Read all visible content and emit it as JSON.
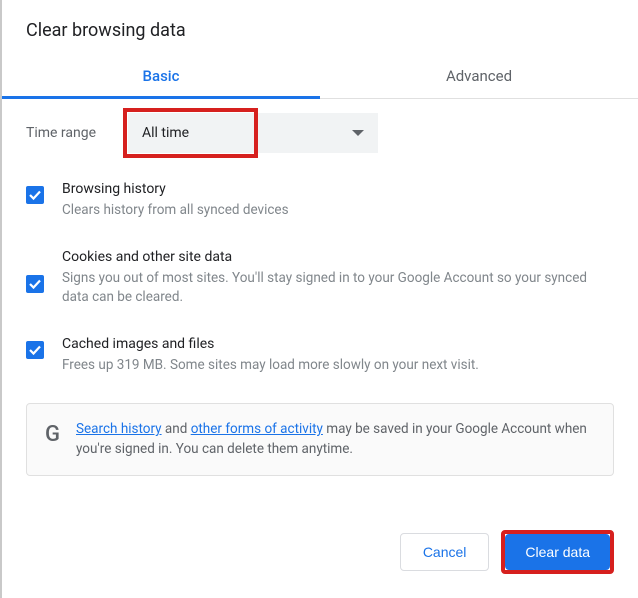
{
  "title": "Clear browsing data",
  "tabs": {
    "basic": "Basic",
    "advanced": "Advanced"
  },
  "time_range": {
    "label": "Time range",
    "selected": "All time"
  },
  "options": [
    {
      "title": "Browsing history",
      "desc": "Clears history from all synced devices"
    },
    {
      "title": "Cookies and other site data",
      "desc": "Signs you out of most sites. You'll stay signed in to your Google Account so your synced data can be cleared."
    },
    {
      "title": "Cached images and files",
      "desc": "Frees up 319 MB. Some sites may load more slowly on your next visit."
    }
  ],
  "info": {
    "link1": "Search history",
    "mid1": " and ",
    "link2": "other forms of activity",
    "rest": " may be saved in your Google Account when you're signed in. You can delete them anytime."
  },
  "buttons": {
    "cancel": "Cancel",
    "clear": "Clear data"
  }
}
